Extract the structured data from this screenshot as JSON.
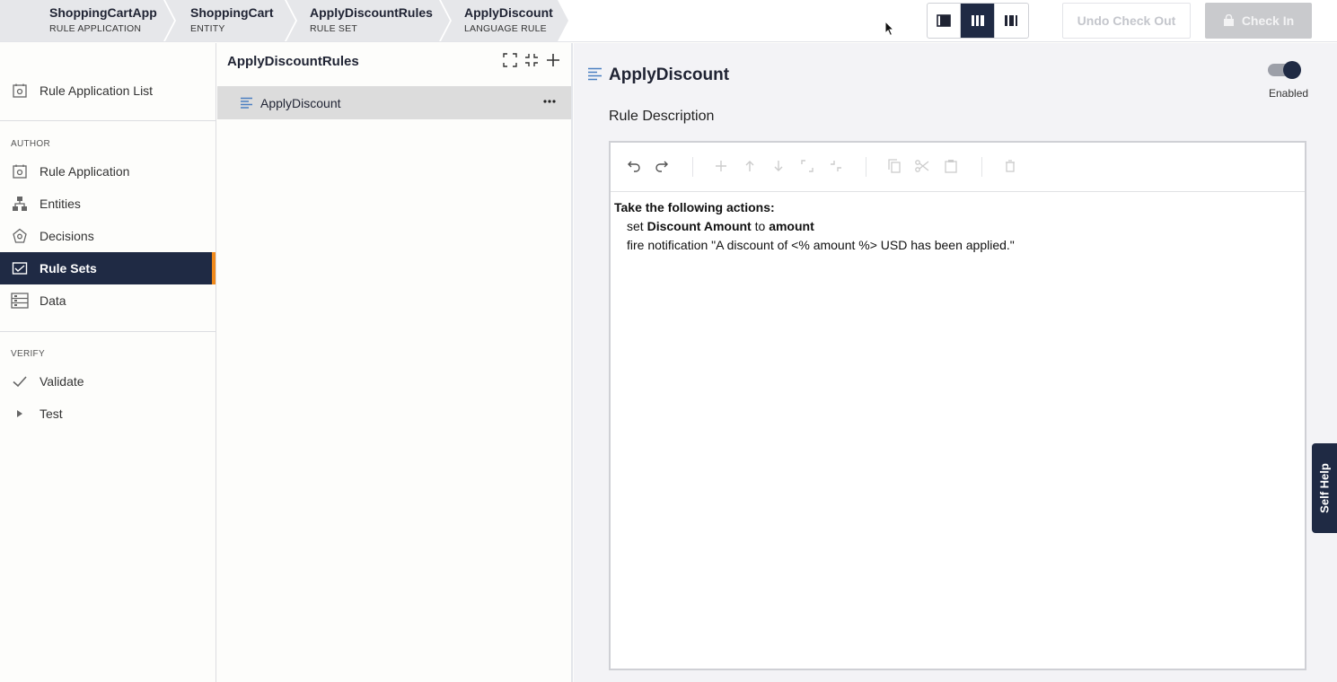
{
  "breadcrumbs": [
    {
      "title": "ShoppingCartApp",
      "subtitle": "RULE APPLICATION"
    },
    {
      "title": "ShoppingCart",
      "subtitle": "ENTITY"
    },
    {
      "title": "ApplyDiscountRules",
      "subtitle": "RULE SET"
    },
    {
      "title": "ApplyDiscount",
      "subtitle": "LANGUAGE RULE"
    }
  ],
  "toolbar": {
    "layout_modes": [
      "left-panel-layout-icon",
      "three-column-layout-icon",
      "right-panel-layout-icon"
    ],
    "active_layout": "three-column-layout-icon",
    "undo_checkout_label": "Undo Check Out",
    "checkin_label": "Check In"
  },
  "sidebar": {
    "top_item": {
      "label": "Rule Application List",
      "icon": "rule-application-list-icon"
    },
    "author_label": "AUTHOR",
    "author_items": [
      {
        "label": "Rule Application",
        "icon": "rule-application-icon"
      },
      {
        "label": "Entities",
        "icon": "entities-icon"
      },
      {
        "label": "Decisions",
        "icon": "decisions-icon"
      },
      {
        "label": "Rule Sets",
        "icon": "rule-sets-icon",
        "active": true
      },
      {
        "label": "Data",
        "icon": "data-icon"
      }
    ],
    "verify_label": "VERIFY",
    "verify_items": [
      {
        "label": "Validate",
        "icon": "checkmark-icon"
      },
      {
        "label": "Test",
        "icon": "play-icon"
      }
    ]
  },
  "ruleset_panel": {
    "title": "ApplyDiscountRules",
    "items": [
      {
        "label": "ApplyDiscount",
        "selected": true
      }
    ]
  },
  "rule": {
    "title": "ApplyDiscount",
    "enabled": true,
    "enabled_label": "Enabled",
    "description_label": "Rule Description",
    "body": {
      "heading": "Take the following actions:",
      "line1": {
        "prefix": "set ",
        "field": "Discount Amount",
        "mid": " to ",
        "value": "amount"
      },
      "line2": "fire notification \"A discount of <% amount %> USD has been applied.\""
    }
  },
  "editor_toolbar": [
    "undo-icon",
    "redo-icon",
    "add-icon",
    "move-up-icon",
    "move-down-icon",
    "expand-icon",
    "collapse-icon",
    "copy-icon",
    "cut-icon",
    "paste-icon",
    "delete-icon"
  ],
  "self_help_label": "Self Help",
  "colors": {
    "nav_active_bg": "#1f2a44",
    "nav_active_accent": "#f08a1c",
    "breadcrumb_bg": "#e6e7ea"
  }
}
